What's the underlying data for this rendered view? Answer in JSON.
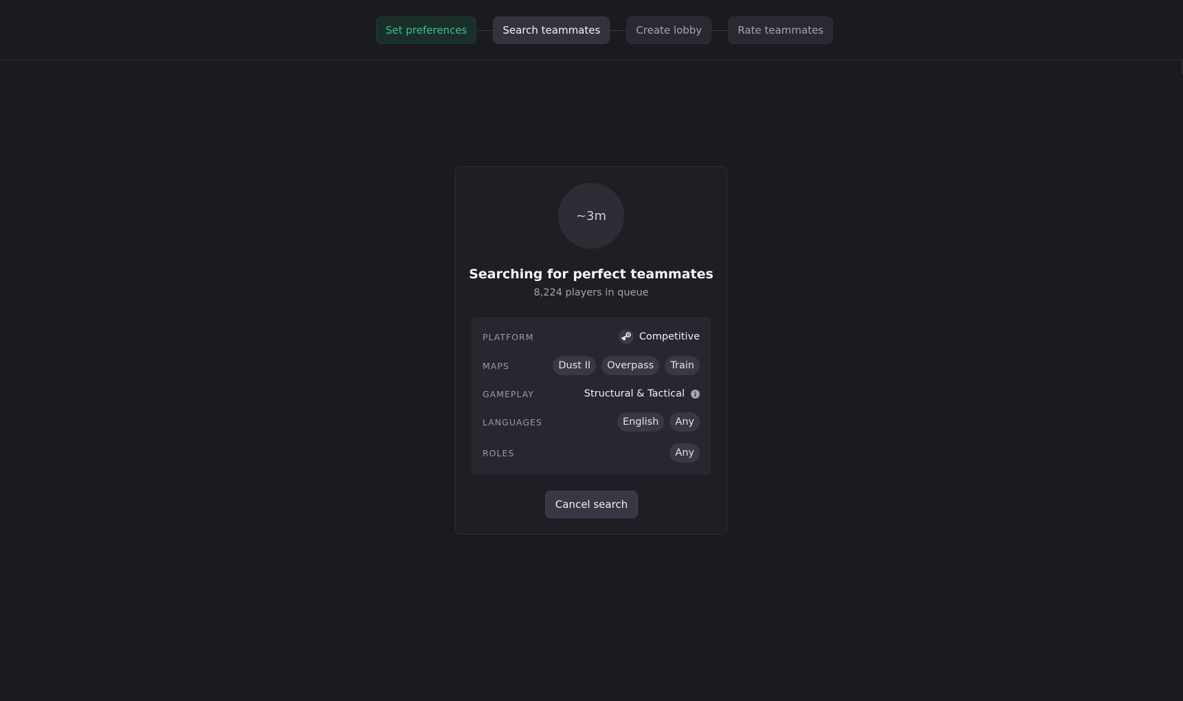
{
  "stepper": {
    "steps": [
      {
        "label": "Set preferences",
        "state": "done"
      },
      {
        "label": "Search teammates",
        "state": "active"
      },
      {
        "label": "Create lobby",
        "state": "pending"
      },
      {
        "label": "Rate teammates",
        "state": "pending"
      }
    ]
  },
  "search": {
    "timer": "~3m",
    "title": "Searching for perfect teammates",
    "queue": "8,224 players in queue"
  },
  "preferences": {
    "platform": {
      "label": "PLATFORM",
      "icon": "steam-icon",
      "value": "Competitive"
    },
    "maps": {
      "label": "MAPS",
      "values": [
        "Dust II",
        "Overpass",
        "Train"
      ]
    },
    "gameplay": {
      "label": "GAMEPLAY",
      "value": "Structural & Tactical",
      "icon": "info-icon"
    },
    "languages": {
      "label": "LANGUAGES",
      "values": [
        "English",
        "Any"
      ]
    },
    "roles": {
      "label": "ROLES",
      "values": [
        "Any"
      ]
    }
  },
  "actions": {
    "cancel_label": "Cancel search"
  },
  "colors": {
    "background": "#1b1a20",
    "card": "#1f1e25",
    "accent_done": "#37c493",
    "chip": "#3a3942"
  }
}
